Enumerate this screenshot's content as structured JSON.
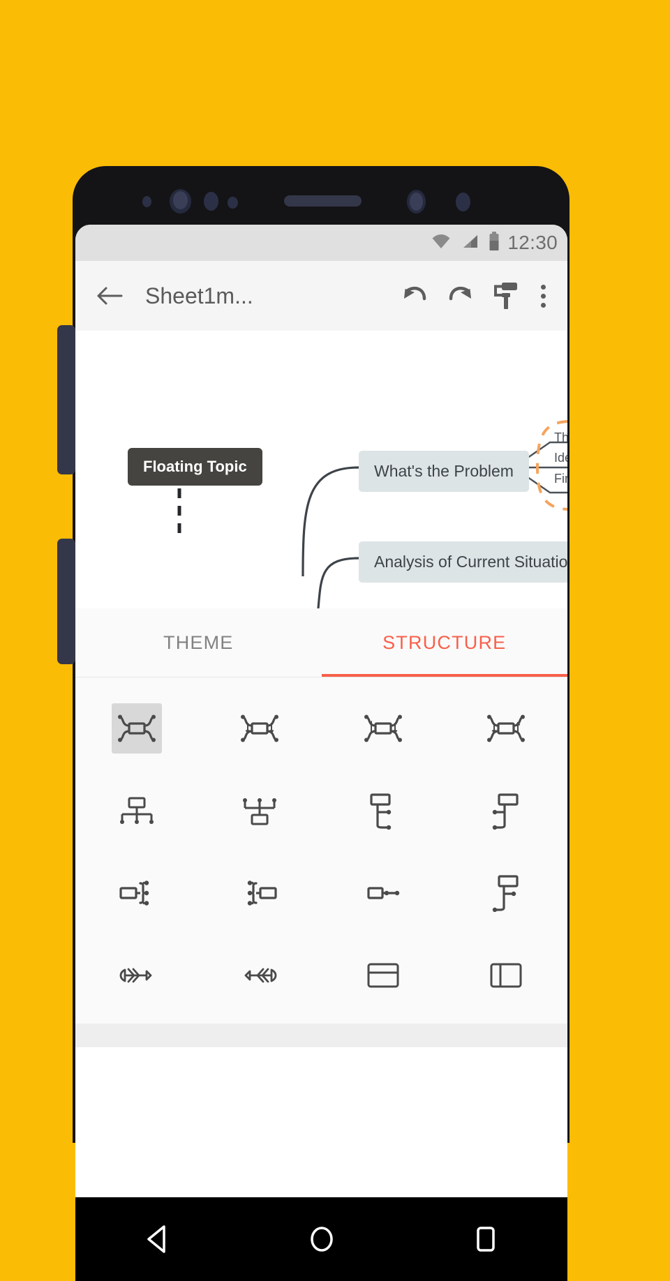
{
  "background": {
    "color": "#FBBC05"
  },
  "device": {
    "name": "android-phone",
    "frame_color": "#141417",
    "button_color": "#343749"
  },
  "status_bar": {
    "time": "12:30",
    "icons": [
      "wifi-icon",
      "cellular-signal-icon",
      "battery-icon"
    ]
  },
  "app_bar": {
    "back_icon": "back-arrow-icon",
    "title": "Sheet1m...",
    "actions": [
      {
        "icon": "undo-icon",
        "label": "Undo"
      },
      {
        "icon": "redo-icon",
        "label": "Redo"
      },
      {
        "icon": "paint-roller-icon",
        "label": "Style"
      },
      {
        "icon": "overflow-menu-icon",
        "label": "More options"
      }
    ]
  },
  "canvas": {
    "floating_topic": {
      "label": "Floating Topic",
      "fill": "#454440",
      "text_color": "#ffffff"
    },
    "nodes": [
      {
        "label": "What's the Problem",
        "fill": "#dde4e6"
      },
      {
        "label": "Analysis of Current Situation",
        "fill": "#dde4e6"
      }
    ],
    "subnodes": [
      {
        "label": "Th"
      },
      {
        "label": "Ide"
      },
      {
        "label": "Fin"
      }
    ],
    "boundary_color": "#F5A45C",
    "connector_color": "#3d4349"
  },
  "tabs": [
    {
      "label": "THEME",
      "active": false
    },
    {
      "label": "STRUCTURE",
      "active": true
    }
  ],
  "accent_color": "#F8604A",
  "structures": [
    {
      "name": "map-balanced",
      "selected": true
    },
    {
      "name": "map-both-sides-down",
      "selected": false
    },
    {
      "name": "map-numbered-both",
      "selected": false
    },
    {
      "name": "map-arrows-both",
      "selected": false
    },
    {
      "name": "org-chart-down",
      "selected": false
    },
    {
      "name": "org-chart-up",
      "selected": false
    },
    {
      "name": "tree-right",
      "selected": false
    },
    {
      "name": "tree-right-alt",
      "selected": false
    },
    {
      "name": "logic-right",
      "selected": false
    },
    {
      "name": "logic-left",
      "selected": false
    },
    {
      "name": "timeline-horizontal",
      "selected": false
    },
    {
      "name": "tree-table-right",
      "selected": false
    },
    {
      "name": "fishbone-left",
      "selected": false
    },
    {
      "name": "fishbone-right",
      "selected": false
    },
    {
      "name": "matrix-rows",
      "selected": false
    },
    {
      "name": "matrix-columns",
      "selected": false
    }
  ],
  "nav_bar": {
    "buttons": [
      {
        "icon": "nav-back-icon",
        "label": "Back"
      },
      {
        "icon": "nav-home-icon",
        "label": "Home"
      },
      {
        "icon": "nav-recents-icon",
        "label": "Recents"
      }
    ]
  }
}
